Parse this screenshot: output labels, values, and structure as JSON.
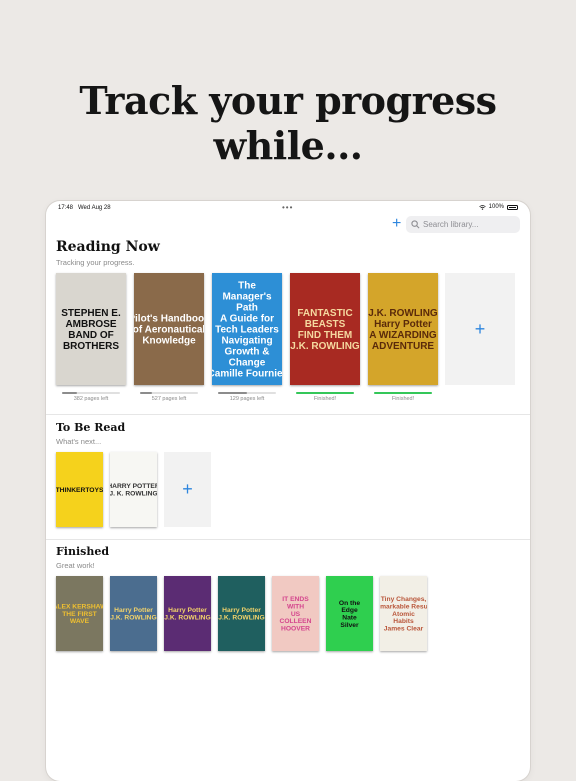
{
  "headline": "Track your progress while...",
  "status_bar": {
    "time": "17:48",
    "date": "Wed Aug 28",
    "battery": "100%"
  },
  "search": {
    "placeholder": "Search library..."
  },
  "toolbar": {
    "add_symbol": "+"
  },
  "sections": {
    "reading_now": {
      "title": "Reading Now",
      "subtitle": "Tracking your progress."
    },
    "to_be_read": {
      "title": "To Be Read",
      "subtitle": "What's next..."
    },
    "finished": {
      "title": "Finished",
      "subtitle": "Great work!"
    }
  },
  "reading_now_books": [
    {
      "cover_lines": [
        "STEPHEN E.",
        "AMBROSE",
        "BAND OF",
        "BROTHERS"
      ],
      "bg": "#d9d6cf",
      "fg": "#111111",
      "progress": 0.25,
      "progress_label": "382 pages left"
    },
    {
      "cover_lines": [
        "Pilot's Handbook",
        "of Aeronautical",
        "Knowledge"
      ],
      "bg": "#8a6a4a",
      "fg": "#ffffff",
      "progress": 0.2,
      "progress_label": "527 pages left"
    },
    {
      "cover_lines": [
        "The",
        "Manager's",
        "Path",
        "A Guide for",
        "Tech Leaders",
        "Navigating",
        "Growth &",
        "Change",
        "Camille Fournier"
      ],
      "bg": "#2d8fd6",
      "fg": "#ffffff",
      "progress": 0.5,
      "progress_label": "129 pages left"
    },
    {
      "cover_lines": [
        "FANTASTIC",
        "BEASTS",
        "FIND THEM",
        "J.K. ROWLING"
      ],
      "bg": "#a82a22",
      "fg": "#f5d9a0",
      "progress": 1,
      "progress_label": "Finished!"
    },
    {
      "cover_lines": [
        "J.K. ROWLING",
        "Harry Potter",
        "A WIZARDING",
        "ADVENTURE"
      ],
      "bg": "#d4a52a",
      "fg": "#5a2a0a",
      "progress": 1,
      "progress_label": "Finished!"
    }
  ],
  "to_be_read_books": [
    {
      "cover_lines": [
        "THINKERTOYS"
      ],
      "bg": "#f5d21c",
      "fg": "#111111"
    },
    {
      "cover_lines": [
        "HARRY POTTER",
        "J. K. ROWLING"
      ],
      "bg": "#f7f7f3",
      "fg": "#333333"
    }
  ],
  "finished_books": [
    {
      "cover_lines": [
        "ALEX KERSHAW",
        "THE FIRST",
        "WAVE"
      ],
      "bg": "#7b7760",
      "fg": "#f0c030"
    },
    {
      "cover_lines": [
        "Harry Potter",
        "J.K. ROWLING"
      ],
      "bg": "#4b6d8f",
      "fg": "#f3d36a"
    },
    {
      "cover_lines": [
        "Harry Potter",
        "J.K. ROWLING"
      ],
      "bg": "#5b2c73",
      "fg": "#f3d36a"
    },
    {
      "cover_lines": [
        "Harry Potter",
        "J.K. ROWLING"
      ],
      "bg": "#1f5f5f",
      "fg": "#f3d36a"
    },
    {
      "cover_lines": [
        "IT ENDS",
        "WITH",
        "US",
        "COLLEEN",
        "HOOVER"
      ],
      "bg": "#f1c9c2",
      "fg": "#d4458d"
    },
    {
      "cover_lines": [
        "On the",
        "Edge",
        "Nate",
        "Silver"
      ],
      "bg": "#2fcf4f",
      "fg": "#111111"
    },
    {
      "cover_lines": [
        "Tiny Changes,",
        "Remarkable Results",
        "Atomic",
        "Habits",
        "James Clear"
      ],
      "bg": "#f2efe6",
      "fg": "#b9563a"
    }
  ],
  "icons": {
    "search": "search-icon",
    "add": "plus-icon",
    "wifi": "wifi-icon",
    "battery": "battery-icon"
  },
  "colors": {
    "accent": "#2e86de",
    "finished": "#34c759"
  }
}
